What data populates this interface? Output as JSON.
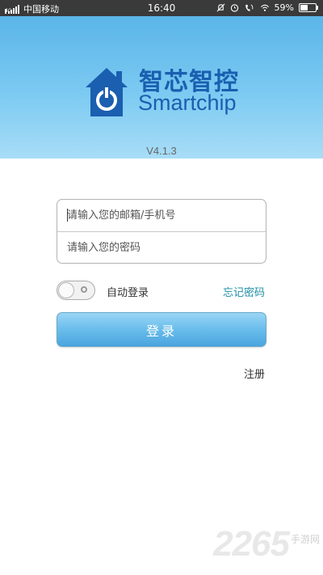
{
  "status_bar": {
    "network_type": "4G",
    "carrier": "中国移动",
    "time": "16:40",
    "battery": "59%",
    "battery_level": 0.59,
    "icons": [
      "signal-icon",
      "bell-off-icon",
      "alarm-icon",
      "call-icon",
      "wifi-icon",
      "battery-icon"
    ]
  },
  "header": {
    "brand_cn": "智芯智控",
    "brand_en": "Smartchip",
    "version": "V4.1.3",
    "colors": {
      "header_top": "#5ab5e8",
      "header_bottom": "#a8ddf7",
      "brand": "#1a5fb0"
    }
  },
  "form": {
    "account_placeholder": "请输入您的邮箱/手机号",
    "password_placeholder": "请输入您的密码",
    "auto_login_label": "自动登录",
    "auto_login_on": false,
    "forgot_password": "忘记密码",
    "login_button": "登录",
    "register": "注册",
    "colors": {
      "accent": "#4aa4de",
      "link": "#1f8fa6"
    }
  },
  "watermark": {
    "number": "2265",
    "suffix": "手游网"
  }
}
